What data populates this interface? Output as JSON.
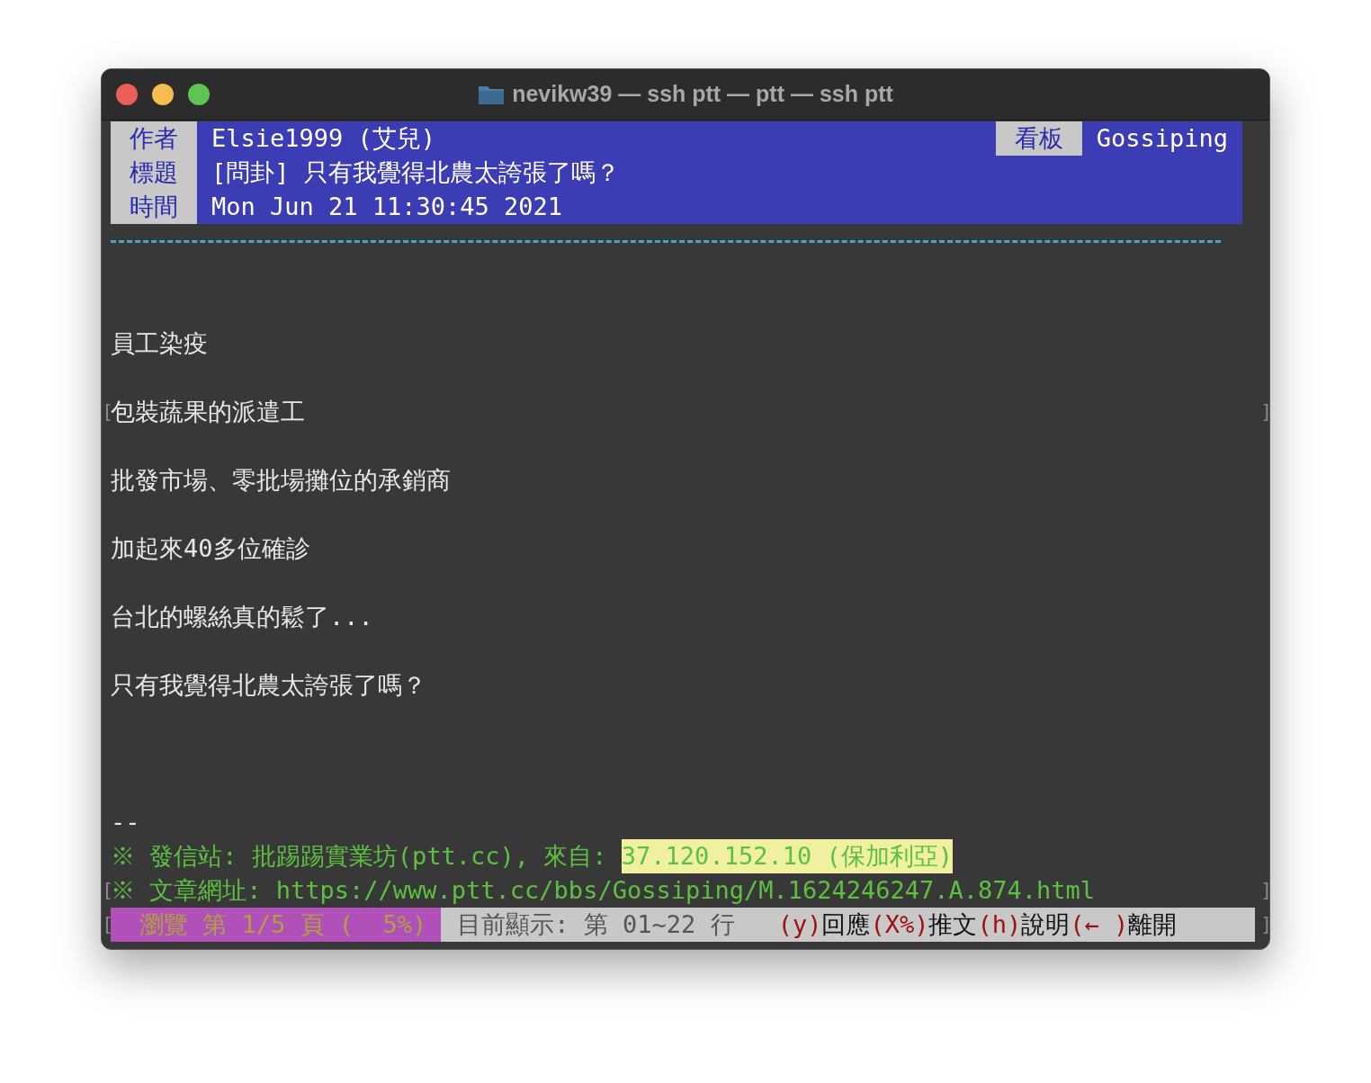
{
  "window": {
    "title": "nevikw39 — ssh ptt — ptt — ssh ptt"
  },
  "header": {
    "rows": [
      {
        "label": "作者",
        "value": "Elsie1999 (艾兒)"
      },
      {
        "label": "標題",
        "value": "[問卦] 只有我覺得北農太誇張了嗎？"
      },
      {
        "label": "時間",
        "value": "Mon Jun 21 11:30:45 2021"
      }
    ],
    "board": {
      "label": "看板",
      "value": "Gossiping"
    }
  },
  "lines": [
    {
      "kind": "blank"
    },
    {
      "kind": "blank"
    },
    {
      "kind": "text",
      "text": "員工染疫"
    },
    {
      "kind": "blank"
    },
    {
      "kind": "text",
      "text": "包裝蔬果的派遣工",
      "edge_left": "[",
      "edge_right": "]"
    },
    {
      "kind": "blank"
    },
    {
      "kind": "text",
      "text": "批發市場、零批場攤位的承銷商"
    },
    {
      "kind": "blank"
    },
    {
      "kind": "text",
      "text": "加起來40多位確診"
    },
    {
      "kind": "blank"
    },
    {
      "kind": "text",
      "text": "台北的螺絲真的鬆了..."
    },
    {
      "kind": "blank"
    },
    {
      "kind": "text",
      "text": "只有我覺得北農太誇張了嗎？"
    },
    {
      "kind": "blank"
    },
    {
      "kind": "blank"
    },
    {
      "kind": "blank"
    },
    {
      "kind": "text",
      "text": "--"
    },
    {
      "kind": "origin",
      "text": "※ 發信站: 批踢踢實業坊(ptt.cc), 來自: ",
      "highlight": "37.120.152.10 (保加利亞)"
    },
    {
      "kind": "origin",
      "text": "※ 文章網址: https://www.ptt.cc/bbs/Gossiping/M.1624246247.A.874.html",
      "edge_left": "[",
      "edge_right": "]"
    }
  ],
  "status_bar": {
    "edge_left": "[",
    "edge_right": "]",
    "page": "瀏覽 第 1/5 頁 (  5%)",
    "display": "目前顯示: 第 01~22 行",
    "keys": [
      {
        "key": "(y)",
        "label": "回應"
      },
      {
        "key": "(X%)",
        "label": "推文"
      },
      {
        "key": "(h)",
        "label": "說明"
      },
      {
        "key": "(← )",
        "label": "離開"
      }
    ]
  }
}
